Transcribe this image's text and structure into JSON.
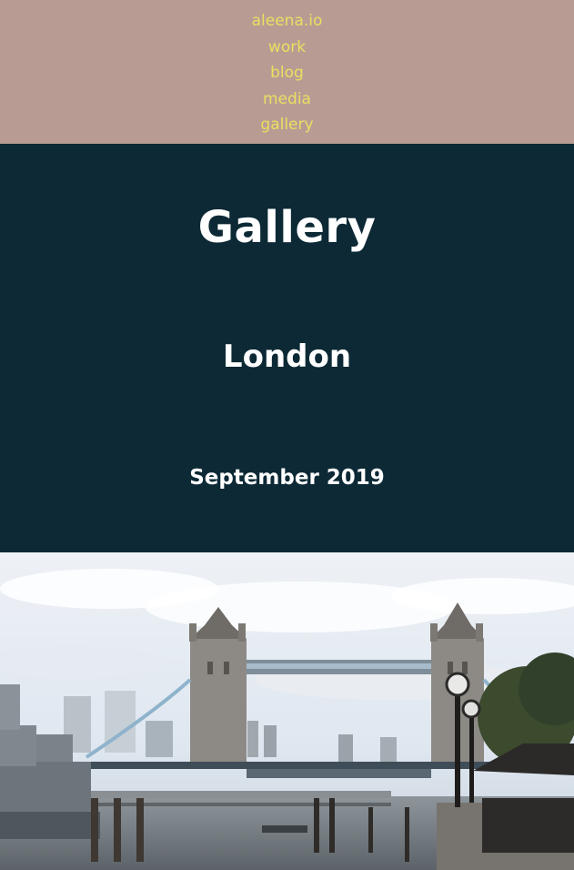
{
  "nav": {
    "site": "aleena.io",
    "items": [
      "work",
      "blog",
      "media",
      "gallery"
    ]
  },
  "hero": {
    "title": "Gallery",
    "subtitle": "London",
    "date": "September 2019"
  },
  "colors": {
    "nav_bg": "#b89c94",
    "nav_link": "#e7e061",
    "hero_bg": "#0c2935",
    "hero_text": "#ffffff"
  }
}
